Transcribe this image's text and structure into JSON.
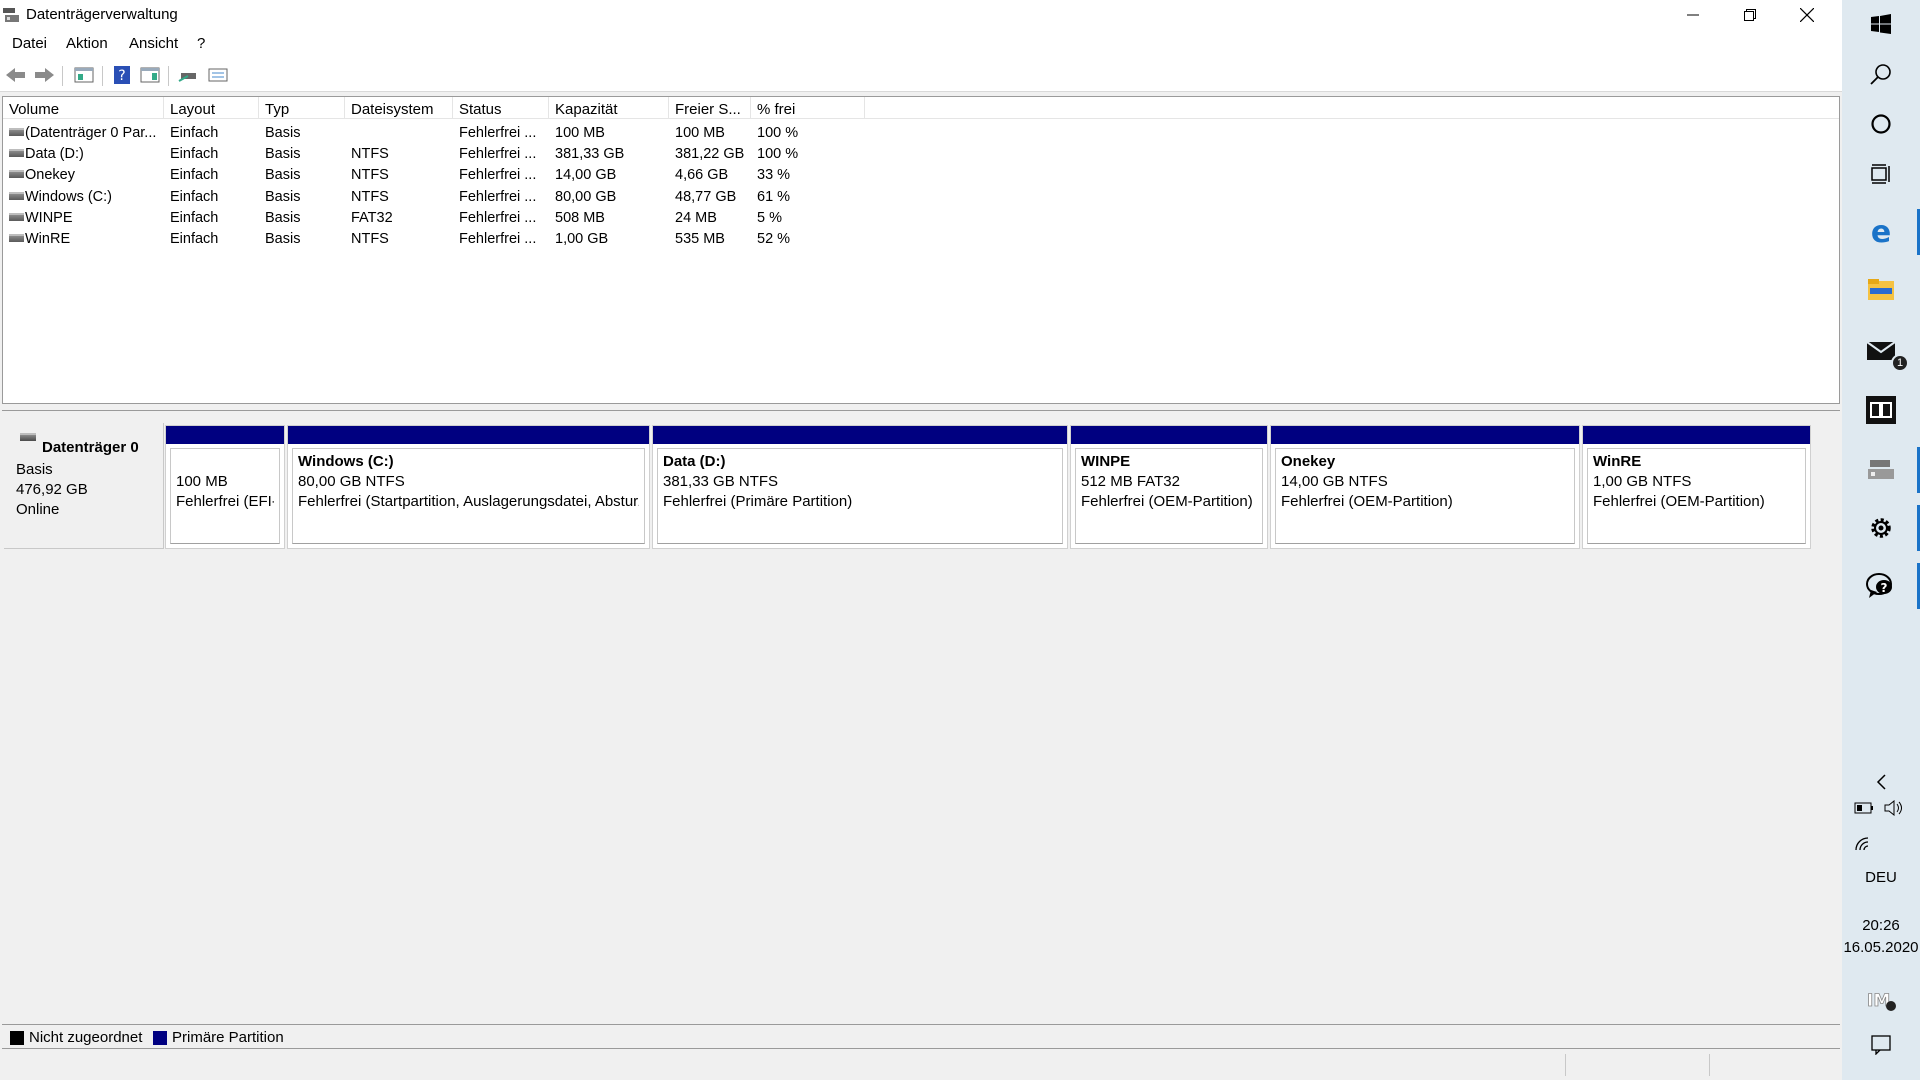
{
  "window": {
    "title": "Datenträgerverwaltung",
    "controls": {
      "minimize": "minimize-icon",
      "maximize": "restore-icon",
      "close": "close-icon"
    }
  },
  "menu": [
    "Datei",
    "Aktion",
    "Ansicht",
    "?"
  ],
  "toolbar": [
    "back-arrow-icon",
    "forward-arrow-icon",
    "console-tree-icon",
    "help-icon",
    "action-pane-icon",
    "connect-disk-icon",
    "properties-icon"
  ],
  "volume_list": {
    "columns": [
      "Volume",
      "Layout",
      "Typ",
      "Dateisystem",
      "Status",
      "Kapazität",
      "Freier S...",
      "% frei"
    ],
    "rows": [
      [
        "(Datenträger 0 Par...",
        "Einfach",
        "Basis",
        "",
        "Fehlerfrei ...",
        "100 MB",
        "100 MB",
        "100 %"
      ],
      [
        "Data (D:)",
        "Einfach",
        "Basis",
        "NTFS",
        "Fehlerfrei ...",
        "381,33 GB",
        "381,22 GB",
        "100 %"
      ],
      [
        "Onekey",
        "Einfach",
        "Basis",
        "NTFS",
        "Fehlerfrei ...",
        "14,00 GB",
        "4,66 GB",
        "33 %"
      ],
      [
        "Windows (C:)",
        "Einfach",
        "Basis",
        "NTFS",
        "Fehlerfrei ...",
        "80,00 GB",
        "48,77 GB",
        "61 %"
      ],
      [
        "WINPE",
        "Einfach",
        "Basis",
        "FAT32",
        "Fehlerfrei ...",
        "508 MB",
        "24 MB",
        "5 %"
      ],
      [
        "WinRE",
        "Einfach",
        "Basis",
        "NTFS",
        "Fehlerfrei ...",
        "1,00 GB",
        "535 MB",
        "52 %"
      ]
    ]
  },
  "disk": {
    "name": "Datenträger 0",
    "type": "Basis",
    "size": "476,92 GB",
    "state": "Online",
    "partitions": [
      {
        "name": "",
        "size": "100 MB",
        "status": "Fehlerfrei (EFI-Systempartition)"
      },
      {
        "name": "Windows  (C:)",
        "size": "80,00 GB NTFS",
        "status": "Fehlerfrei (Startpartition, Auslagerungsdatei, Absturzabbild, Primäre Partition)"
      },
      {
        "name": "Data  (D:)",
        "size": "381,33 GB NTFS",
        "status": "Fehlerfrei (Primäre Partition)"
      },
      {
        "name": "WINPE",
        "size": "512 MB FAT32",
        "status": "Fehlerfrei (OEM-Partition)"
      },
      {
        "name": "Onekey",
        "size": "14,00 GB NTFS",
        "status": "Fehlerfrei (OEM-Partition)"
      },
      {
        "name": "WinRE",
        "size": "1,00 GB NTFS",
        "status": "Fehlerfrei (OEM-Partition)"
      }
    ]
  },
  "legend": [
    {
      "label": "Nicht zugeordnet",
      "color": "#000000"
    },
    {
      "label": "Primäre Partition",
      "color": "#000080"
    }
  ],
  "taskbar": {
    "icons": [
      "windows-start-icon",
      "search-icon",
      "cortana-icon",
      "task-view-icon",
      "edge-icon",
      "file-explorer-icon",
      "mail-icon",
      "reader-icon",
      "disk-management-icon",
      "settings-icon",
      "feedback-hub-icon"
    ],
    "mail_badge": "1",
    "language": "DEU",
    "time": "20:26",
    "date": "16.05.2020",
    "accent": "#1a73c8"
  }
}
